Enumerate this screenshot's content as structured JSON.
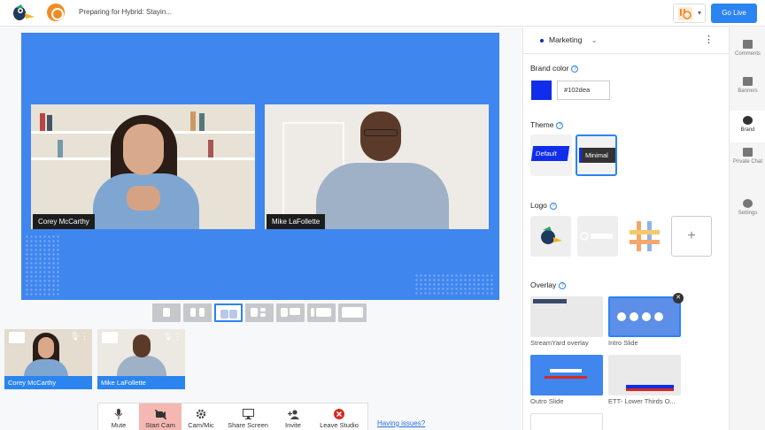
{
  "topbar": {
    "title": "Preparing for Hybrid: Stayin...",
    "go_live": "Go Live"
  },
  "stage": {
    "participants": [
      {
        "name": "Corey McCarthy"
      },
      {
        "name": "Mike LaFollette"
      }
    ]
  },
  "backstage": [
    {
      "name": "Corey McCarthy"
    },
    {
      "name": "Mike LaFollette"
    }
  ],
  "controls": [
    {
      "label": "Mute",
      "icon": "mic-icon"
    },
    {
      "label": "Start Cam",
      "icon": "camera-off-icon"
    },
    {
      "label": "Cam/Mic",
      "icon": "gear-icon"
    },
    {
      "label": "Share Screen",
      "icon": "monitor-icon"
    },
    {
      "label": "Invite",
      "icon": "add-person-icon"
    },
    {
      "label": "Leave Studio",
      "icon": "close-circle-icon"
    }
  ],
  "having_issues": "Having issues?",
  "panel": {
    "brand": "Marketing",
    "brand_color_title": "Brand color",
    "brand_color_hex": "#102dea",
    "theme_title": "Theme",
    "themes": [
      "Default",
      "Minimal"
    ],
    "logo_title": "Logo",
    "overlay_title": "Overlay",
    "overlays": [
      "StreamYard overlay",
      "Intro Slide",
      "Outro Slide",
      "ETT- Lower Thirds O..."
    ]
  },
  "sidebar_tabs": [
    "Comments",
    "Banners",
    "Brand",
    "Private Chat",
    "Settings"
  ],
  "colors": {
    "accent": "#2b84f0",
    "stage_bg": "#3f86ef",
    "brand_color": "#102dea",
    "start_cam_bg": "#f5b7b1",
    "leave_red": "#d52a1f"
  }
}
